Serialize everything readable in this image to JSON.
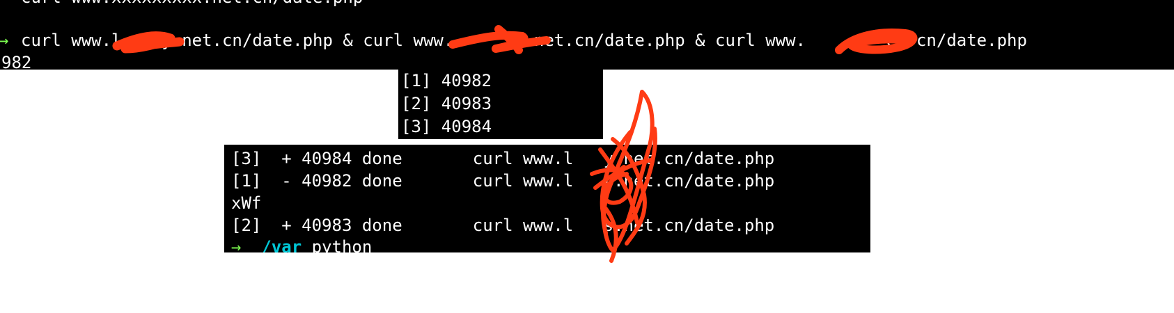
{
  "top_terminal": {
    "cut_off_line": "curl www.xxxxxxxxx.net.cn/date.php",
    "command_line": "curl www.l    y.net.cn/date.php & curl www.       .net.cn/date.php & curl www.        et.cn/date.php",
    "prompt_fragment": "→",
    "pid_line": "982"
  },
  "jobs_terminal": {
    "lines": [
      "[1] 40982",
      "[2] 40983",
      "[3] 40984"
    ]
  },
  "done_terminal": {
    "lines": [
      "[3]  + 40984 done       curl www.l   y.net.cn/date.php",
      "[1]  - 40982 done       curl www.l   y.net.cn/date.php",
      "xWf",
      "[2]  + 40983 done       curl www.l   s.net.cn/date.php"
    ],
    "prompt_arrow": "→",
    "prompt_dir": "/var",
    "prompt_cmd": "python"
  },
  "colors": {
    "terminal_bg": "#000000",
    "terminal_fg": "#ffffff",
    "redaction": "#ff3b14",
    "prompt_arrow": "#7CFC50",
    "prompt_dir": "#00c8d7"
  }
}
